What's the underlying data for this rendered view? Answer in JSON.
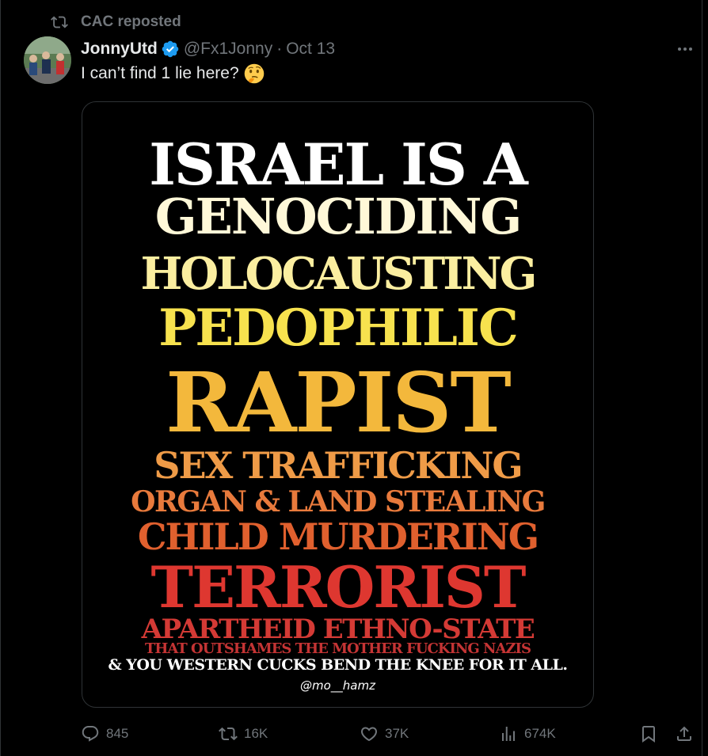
{
  "repost_bar": {
    "icon": "repost-icon",
    "label": "CAC reposted"
  },
  "author": {
    "display_name": "JonnyUtd",
    "verified_icon": "verified-badge-icon",
    "handle": "@Fx1Jonny",
    "separator": "·",
    "date": "Oct 13"
  },
  "more_icon": "more-options-icon",
  "tweet_text": "I can’t find 1 lie here?",
  "tweet_emoji": "thinking-face-icon",
  "media": {
    "lines": [
      "ISRAEL IS A",
      "GENOCIDING",
      "HOLOCAUSTING",
      "PEDOPHILIC",
      "RAPIST",
      "SEX TRAFFICKING",
      "ORGAN & LAND STEALING",
      "CHILD MURDERING",
      "TERRORIST",
      "APARTHEID ETHNO-STATE",
      "THAT OUTSHAMES THE MOTHER FUCKING NAZIS",
      "& YOU WESTERN CUCKS BEND THE KNEE FOR IT ALL."
    ],
    "signature": "@mo__hamz"
  },
  "actions": {
    "replies": {
      "icon": "reply-icon",
      "count": "845"
    },
    "reposts": {
      "icon": "repost-icon",
      "count": "16K"
    },
    "likes": {
      "icon": "heart-icon",
      "count": "37K"
    },
    "views": {
      "icon": "views-chart-icon",
      "count": "674K"
    },
    "bookmark": {
      "icon": "bookmark-icon"
    },
    "share": {
      "icon": "share-icon"
    }
  },
  "colors": {
    "background": "#000000",
    "text_primary": "#e7e9ea",
    "text_secondary": "#71767b",
    "border": "#2f3336",
    "verified_blue": "#1d9bf0"
  }
}
